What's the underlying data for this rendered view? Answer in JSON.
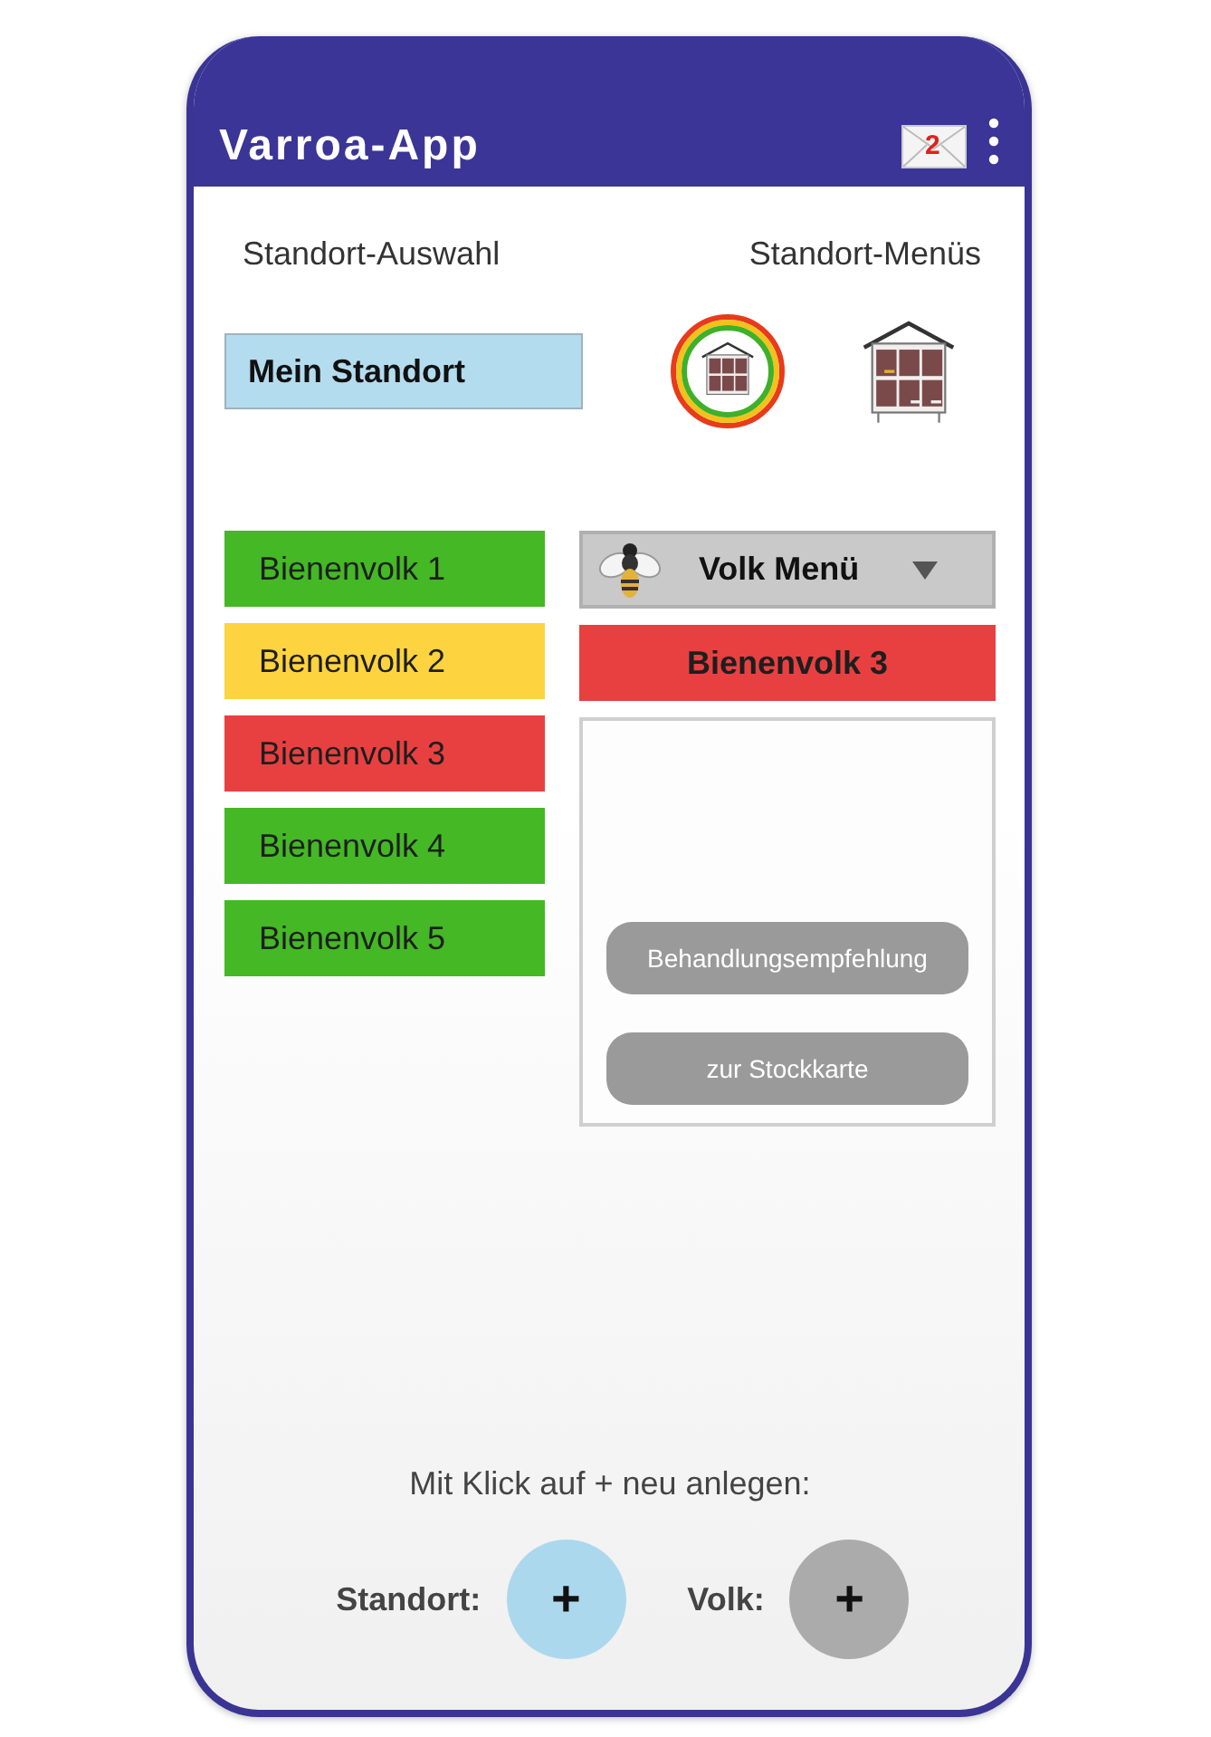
{
  "app_bar": {
    "title": "Varroa-App",
    "mail_badge": "2"
  },
  "location": {
    "heading_left": "Standort-Auswahl",
    "heading_right": "Standort-Menüs",
    "field_value": "Mein Standort"
  },
  "colonies": [
    {
      "label": "Bienenvolk 1",
      "color": "#44b825"
    },
    {
      "label": "Bienenvolk 2",
      "color": "#fdd33f"
    },
    {
      "label": "Bienenvolk 3",
      "color": "#e84040"
    },
    {
      "label": "Bienenvolk 4",
      "color": "#44b825"
    },
    {
      "label": "Bienenvolk 5",
      "color": "#44b825"
    }
  ],
  "colony_menu": {
    "label": "Volk Menü",
    "current": {
      "label": "Bienenvolk 3",
      "color": "#e84040"
    },
    "buttons": [
      "Behandlungsempfehlung",
      "zur Stockkarte"
    ]
  },
  "footer": {
    "hint": "Mit Klick auf + neu anlegen:",
    "actions": [
      {
        "label": "Standort:",
        "symbol": "+",
        "kind": "location"
      },
      {
        "label": "Volk:",
        "symbol": "+",
        "kind": "colony"
      }
    ]
  }
}
